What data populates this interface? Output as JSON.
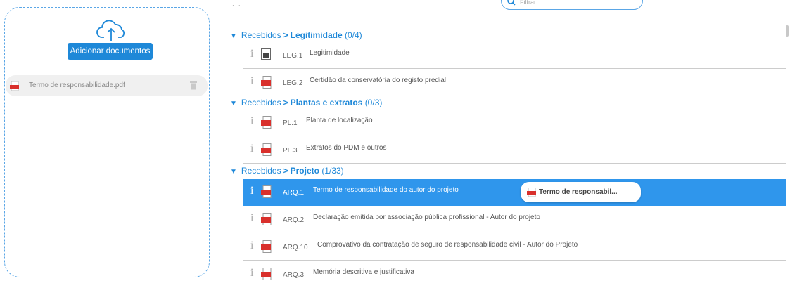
{
  "upload": {
    "add_label": "Adicionar documentos",
    "file_name": "Termo de responsabilidade.pdf"
  },
  "search": {
    "placeholder": "Filtrar"
  },
  "top_dots": "· ·",
  "sections": [
    {
      "received": "Recebidos",
      "sep": ">",
      "title": "Legitimidade",
      "count": "(0/4)",
      "rows": [
        {
          "code": "LEG.1",
          "desc": "Legitimidade",
          "icon": "document-icon"
        },
        {
          "code": "LEG.2",
          "desc": "Certidão da conservatória do registo predial",
          "icon": "pdf-icon"
        }
      ]
    },
    {
      "received": "Recebidos",
      "sep": ">",
      "title": "Plantas e extratos",
      "count": "(0/3)",
      "rows": [
        {
          "code": "PL.1",
          "desc": "Planta de localização",
          "icon": "pdf-icon"
        },
        {
          "code": "PL.3",
          "desc": "Extratos do PDM e outros",
          "icon": "pdf-icon"
        }
      ]
    },
    {
      "received": "Recebidos",
      "sep": ">",
      "title": "Projeto",
      "count": "(1/33)",
      "rows": [
        {
          "code": "ARQ.1",
          "desc": "Termo de responsabilidade do autor do projeto",
          "icon": "pdf-icon",
          "chip": "Termo de responsabil..."
        },
        {
          "code": "ARQ.2",
          "desc": "Declaração emitida por associação pública profissional - Autor do projeto",
          "icon": "pdf-icon"
        },
        {
          "code": "ARQ.10",
          "desc": "Comprovativo da contratação de seguro de responsabilidade civil - Autor do Projeto",
          "icon": "pdf-icon"
        },
        {
          "code": "ARQ.3",
          "desc": "Memória descritiva e justificativa",
          "icon": "pdf-icon"
        }
      ]
    }
  ],
  "colors": {
    "accent": "#1e88d8",
    "selected_row": "#2f96ec",
    "pdf_red": "#d9302c"
  }
}
